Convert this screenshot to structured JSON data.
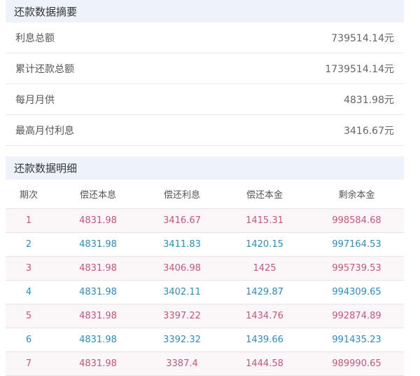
{
  "summary": {
    "title": "还款数据摘要",
    "rows": [
      {
        "label": "利息总额",
        "value": "739514.14元"
      },
      {
        "label": "累计还款总额",
        "value": "1739514.14元"
      },
      {
        "label": "每月月供",
        "value": "4831.98元"
      },
      {
        "label": "最高月付利息",
        "value": "3416.67元"
      }
    ]
  },
  "detail": {
    "title": "还款数据明细",
    "columns": [
      "期次",
      "偿还本息",
      "偿还利息",
      "偿还本金",
      "剩余本金"
    ],
    "rows": [
      [
        "1",
        "4831.98",
        "3416.67",
        "1415.31",
        "998584.68"
      ],
      [
        "2",
        "4831.98",
        "3411.83",
        "1420.15",
        "997164.53"
      ],
      [
        "3",
        "4831.98",
        "3406.98",
        "1425",
        "995739.53"
      ],
      [
        "4",
        "4831.98",
        "3402.11",
        "1429.87",
        "994309.65"
      ],
      [
        "5",
        "4831.98",
        "3397.22",
        "1434.76",
        "992874.89"
      ],
      [
        "6",
        "4831.98",
        "3392.32",
        "1439.66",
        "991435.23"
      ],
      [
        "7",
        "4831.98",
        "3387.4",
        "1444.58",
        "989990.65"
      ]
    ]
  },
  "colors": {
    "header_bg": "#eef3fb",
    "odd_row_text": "#c8557a",
    "even_row_text": "#2f8cc0",
    "odd_row_bg": "#fbf6f8"
  }
}
